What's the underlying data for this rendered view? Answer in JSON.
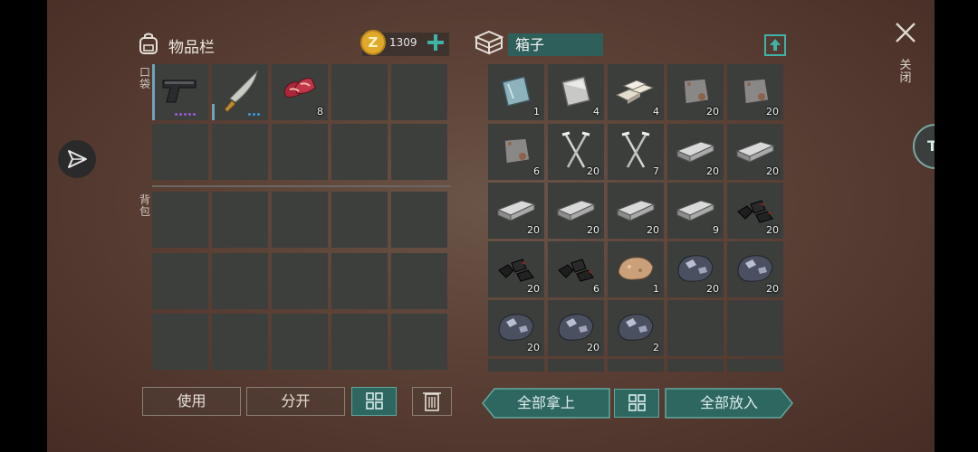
{
  "inventory": {
    "title": "物品栏",
    "coins": "1309",
    "pocket_label": "口袋",
    "backpack_label": "背包",
    "pocket_items": [
      {
        "icon": "pistol-icon",
        "quantity": ""
      },
      {
        "icon": "machete-icon",
        "quantity": ""
      },
      {
        "icon": "raw-meat-icon",
        "quantity": "8"
      }
    ]
  },
  "container": {
    "title": "箱子",
    "items": [
      {
        "icon": "glass-sheet-icon",
        "quantity": "1"
      },
      {
        "icon": "metal-sheet-icon",
        "quantity": "4"
      },
      {
        "icon": "steel-ingots-icon",
        "quantity": "4"
      },
      {
        "icon": "rusty-metal-plate-icon",
        "quantity": "20"
      },
      {
        "icon": "rusty-metal-plate-icon",
        "quantity": "20"
      },
      {
        "icon": "rusty-metal-plate-icon",
        "quantity": "6"
      },
      {
        "icon": "nails-icon",
        "quantity": "20"
      },
      {
        "icon": "nails-icon",
        "quantity": "7"
      },
      {
        "icon": "iron-bar-icon",
        "quantity": "20"
      },
      {
        "icon": "iron-bar-icon",
        "quantity": "20"
      },
      {
        "icon": "iron-bar-icon",
        "quantity": "20"
      },
      {
        "icon": "iron-bar-icon",
        "quantity": "20"
      },
      {
        "icon": "iron-bar-icon",
        "quantity": "20"
      },
      {
        "icon": "iron-bar-icon",
        "quantity": "9"
      },
      {
        "icon": "coal-icon",
        "quantity": "20"
      },
      {
        "icon": "coal-icon",
        "quantity": "20"
      },
      {
        "icon": "coal-icon",
        "quantity": "6"
      },
      {
        "icon": "copper-ore-icon",
        "quantity": "1"
      },
      {
        "icon": "iron-ore-icon",
        "quantity": "20"
      },
      {
        "icon": "iron-ore-icon",
        "quantity": "20"
      },
      {
        "icon": "iron-ore-icon",
        "quantity": "20"
      },
      {
        "icon": "iron-ore-icon",
        "quantity": "20"
      },
      {
        "icon": "iron-ore-icon",
        "quantity": "2"
      },
      {
        "icon": "",
        "quantity": ""
      },
      {
        "icon": "",
        "quantity": ""
      }
    ]
  },
  "buttons": {
    "use": "使用",
    "split": "分开",
    "take_all": "全部拿上",
    "put_all": "全部放入"
  },
  "close_label": "关闭",
  "colors": {
    "accent_teal": "#2e6660",
    "coin_gold": "#e0a92a",
    "plus_teal": "#3fb3a6"
  }
}
